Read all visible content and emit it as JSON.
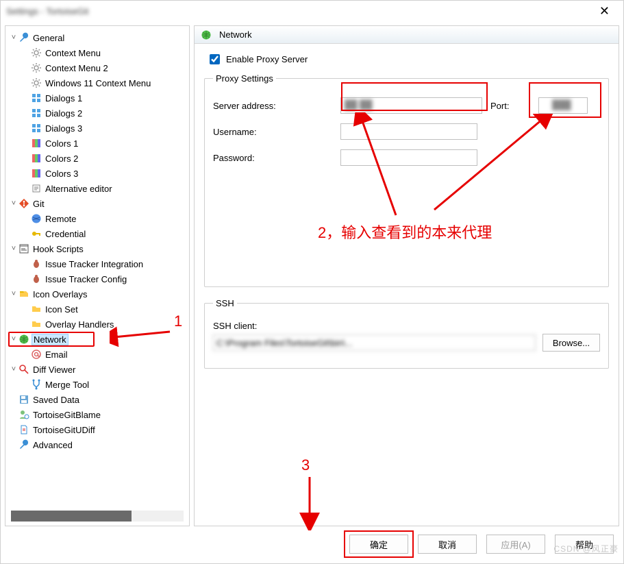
{
  "titlebar": {
    "title": "Settings - TortoiseGit"
  },
  "tree": {
    "general": {
      "label": "General",
      "children": {
        "context_menu": "Context Menu",
        "context_menu_2": "Context Menu 2",
        "win11_context": "Windows 11 Context Menu",
        "dialogs1": "Dialogs 1",
        "dialogs2": "Dialogs 2",
        "dialogs3": "Dialogs 3",
        "colors1": "Colors 1",
        "colors2": "Colors 2",
        "colors3": "Colors 3",
        "alt_editor": "Alternative editor"
      }
    },
    "git": {
      "label": "Git",
      "children": {
        "remote": "Remote",
        "credential": "Credential"
      }
    },
    "hook": {
      "label": "Hook Scripts",
      "children": {
        "iti": "Issue Tracker Integration",
        "itc": "Issue Tracker Config"
      }
    },
    "icon_overlays": {
      "label": "Icon Overlays",
      "children": {
        "icon_set": "Icon Set",
        "overlay_handlers": "Overlay Handlers"
      }
    },
    "network": {
      "label": "Network",
      "children": {
        "email": "Email"
      }
    },
    "diff": {
      "label": "Diff Viewer",
      "children": {
        "merge": "Merge Tool"
      }
    },
    "saved_data": "Saved Data",
    "blame": "TortoiseGitBlame",
    "udiff": "TortoiseGitUDiff",
    "advanced": "Advanced"
  },
  "panel": {
    "title": "Network",
    "enable_proxy": "Enable Proxy Server",
    "proxy_legend": "Proxy Settings",
    "server_address_label": "Server address:",
    "port_label": "Port:",
    "username_label": "Username:",
    "password_label": "Password:",
    "ssh_legend": "SSH",
    "ssh_client_label": "SSH client:",
    "browse": "Browse...",
    "server_value": "",
    "port_value": "",
    "username_value": "",
    "password_value": "",
    "ssh_client_value": ""
  },
  "buttons": {
    "ok": "确定",
    "cancel": "取消",
    "apply": "应用(A)",
    "help": "帮助"
  },
  "annotations": {
    "one": "1",
    "two": "2，输入查看到的本来代理",
    "three": "3"
  },
  "watermark": "CSDN @风正豪"
}
